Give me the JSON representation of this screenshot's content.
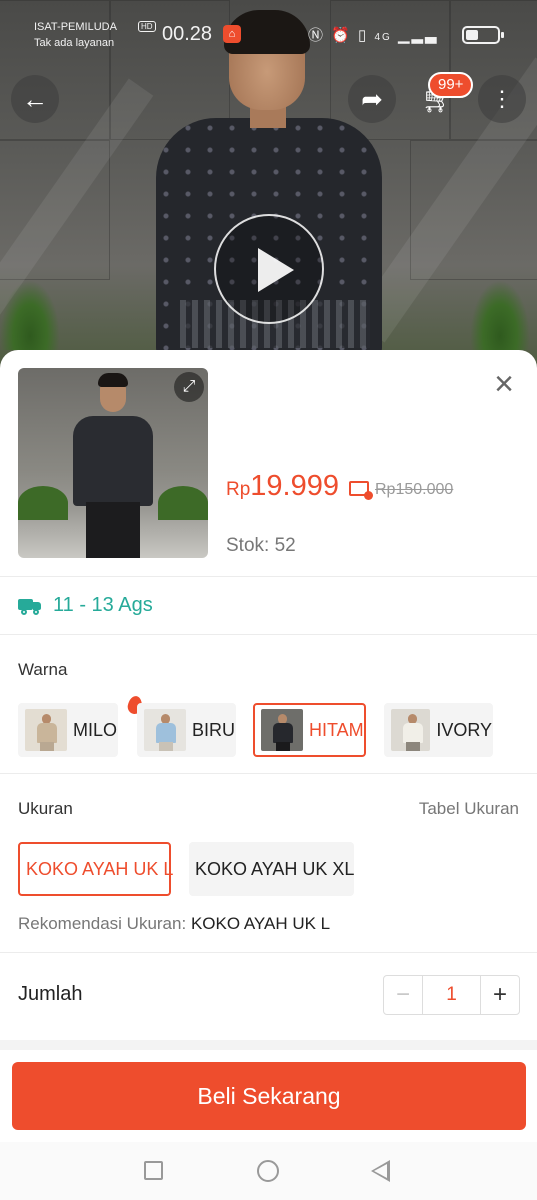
{
  "status_bar": {
    "carrier": "ISAT-PEMILUDA",
    "carrier_sub": "Tak ada layanan",
    "hd": "HD",
    "time": "00.28",
    "network": "4G"
  },
  "top_bar": {
    "cart_badge": "99+"
  },
  "product": {
    "price_currency": "Rp",
    "price_value": "19.999",
    "original_price": "Rp150.000",
    "stock_text": "Stok: 52"
  },
  "shipping": {
    "estimate": "11 - 13 Ags",
    "color": "#26aa99"
  },
  "color_section": {
    "title": "Warna",
    "options": [
      {
        "label": "MILO",
        "selected": false,
        "hot": true
      },
      {
        "label": "BIRU",
        "selected": false,
        "hot": false
      },
      {
        "label": "HITAM",
        "selected": true,
        "hot": false
      },
      {
        "label": "IVORY",
        "selected": false,
        "hot": false
      }
    ]
  },
  "size_section": {
    "title": "Ukuran",
    "size_table_link": "Tabel Ukuran",
    "options": [
      {
        "label": "KOKO AYAH UK L",
        "selected": true
      },
      {
        "label": "KOKO AYAH UK XL",
        "selected": false
      }
    ],
    "recommendation_label": "Rekomendasi Ukuran:",
    "recommendation_value": "KOKO AYAH UK L"
  },
  "quantity": {
    "label": "Jumlah",
    "minus": "−",
    "value": "1",
    "plus": "+"
  },
  "buy_button": {
    "label": "Beli Sekarang"
  },
  "colors": {
    "accent": "#ee4d2d",
    "shipping": "#26aa99"
  }
}
